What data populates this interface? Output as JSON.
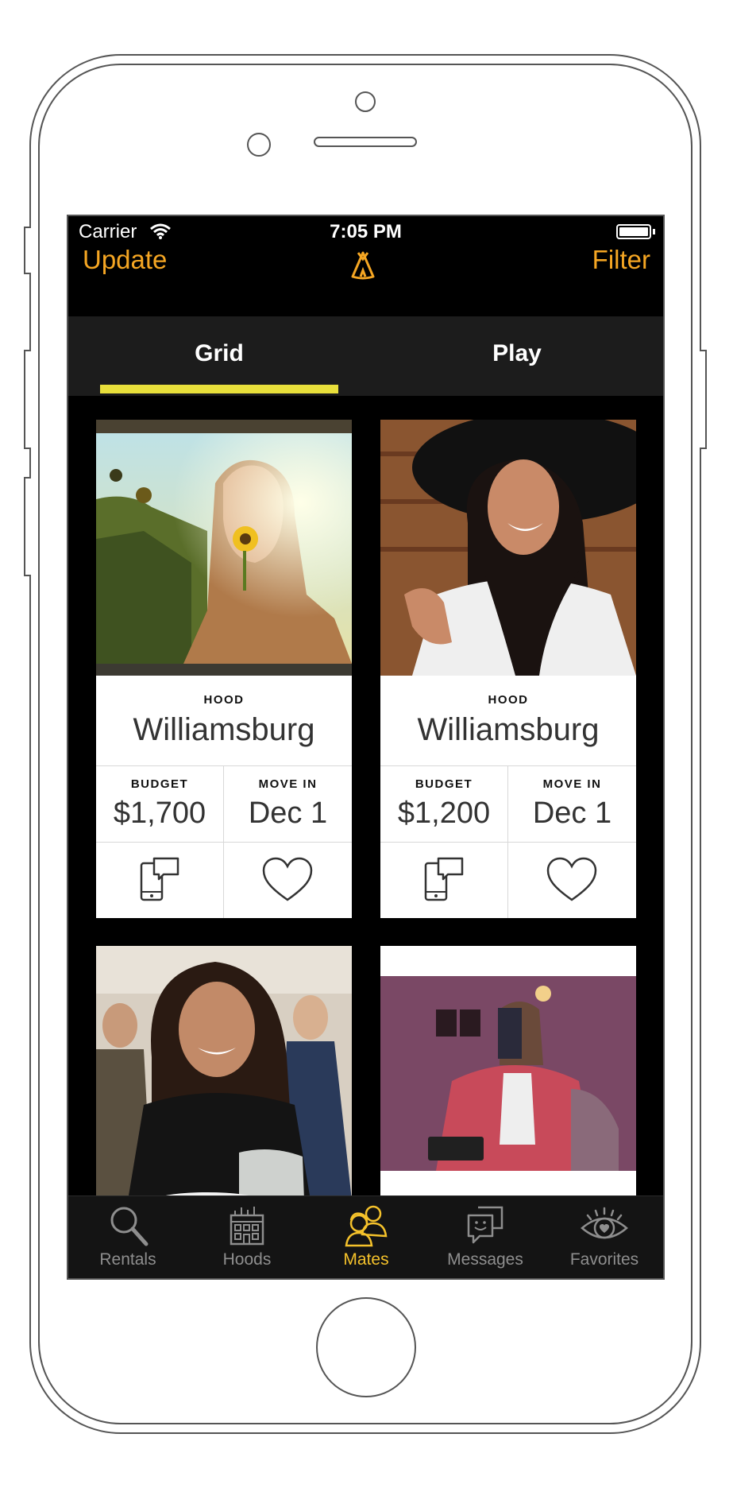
{
  "status_bar": {
    "carrier": "Carrier",
    "time": "7:05 PM"
  },
  "nav": {
    "left": "Update",
    "right": "Filter",
    "logo_icon": "teepee-icon"
  },
  "tabs": [
    {
      "label": "Grid",
      "active": true
    },
    {
      "label": "Play",
      "active": false
    }
  ],
  "cards": [
    {
      "hood_label": "HOOD",
      "hood": "Williamsburg",
      "budget_label": "BUDGET",
      "budget": "$1,700",
      "move_in_label": "MOVE IN",
      "move_in": "Dec 1"
    },
    {
      "hood_label": "HOOD",
      "hood": "Williamsburg",
      "budget_label": "BUDGET",
      "budget": "$1,200",
      "move_in_label": "MOVE IN",
      "move_in": "Dec 1"
    }
  ],
  "tabbar": [
    {
      "label": "Rentals",
      "icon": "magnifier-icon"
    },
    {
      "label": "Hoods",
      "icon": "building-icon"
    },
    {
      "label": "Mates",
      "icon": "people-icon",
      "active": true
    },
    {
      "label": "Messages",
      "icon": "chat-face-icon"
    },
    {
      "label": "Favorites",
      "icon": "eye-heart-icon"
    }
  ],
  "colors": {
    "accent": "#f5a623",
    "tab_underline": "#e8df3b",
    "active_tab_icon": "#f5c22b"
  }
}
